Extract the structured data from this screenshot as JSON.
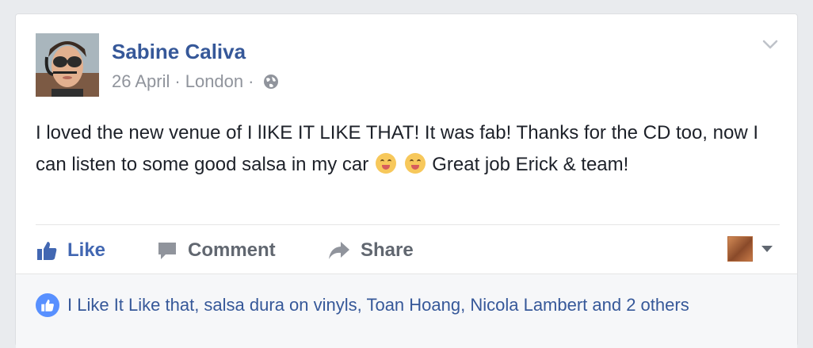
{
  "post": {
    "author": "Sabine Caliva",
    "date": "26 April",
    "location": "London",
    "separator": "·",
    "text_part1": "I loved the new venue of I lIKE IT LIKE THAT! It was fab! Thanks for the CD too, now I can listen to some good salsa in my car",
    "text_part2": "Great job Erick & team!",
    "emoji": "tongue-out-wink-face-icon",
    "visibility_icon": "globe-icon",
    "menu_icon": "chevron-down-icon"
  },
  "actions": {
    "like": "Like",
    "comment": "Comment",
    "share": "Share"
  },
  "reactions": {
    "text": "I Like It Like that, salsa dura on vinyls, Toan Hoang, Nicola Lambert and 2 others"
  },
  "colors": {
    "link": "#365899",
    "like_active": "#4267b2",
    "meta": "#90949c",
    "action": "#616770",
    "like_badge": "#5890ff"
  }
}
